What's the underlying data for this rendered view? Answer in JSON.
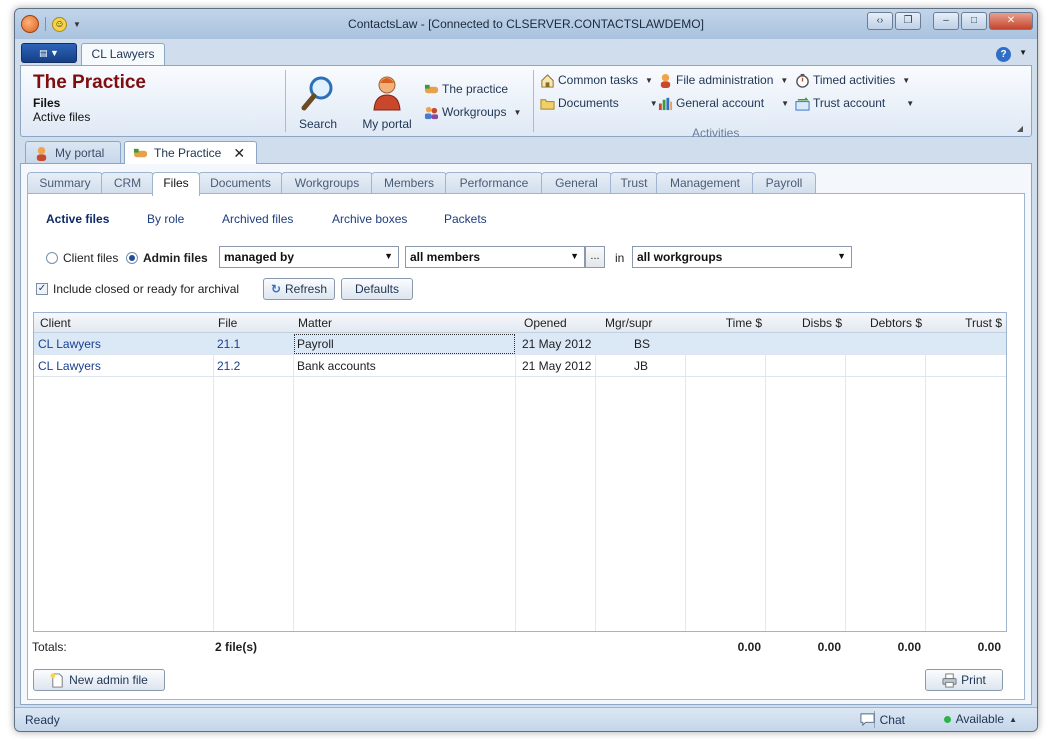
{
  "window": {
    "title": "ContactsLaw - [Connected to CLSERVER.CONTACTSLAWDEMO]"
  },
  "ribbon": {
    "tab_label": "CL Lawyers",
    "practice_title": "The Practice",
    "practice_sub": "Files",
    "practice_sub2": "Active files",
    "search_label": "Search",
    "my_portal_label": "My portal",
    "the_practice_label": "The practice",
    "workgroups_label": "Workgroups",
    "common_tasks_label": "Common tasks",
    "documents_label": "Documents",
    "file_admin_label": "File administration",
    "general_account_label": "General account",
    "timed_activities_label": "Timed activities",
    "trust_account_label": "Trust account",
    "activities_group_label": "Activities"
  },
  "doc_tabs": {
    "my_portal": "My portal",
    "the_practice": "The Practice"
  },
  "inner_tabs": [
    "Summary",
    "CRM",
    "Files",
    "Documents",
    "Workgroups",
    "Members",
    "Performance",
    "General",
    "Trust",
    "Management",
    "Payroll"
  ],
  "active_inner_tab": "Files",
  "subnav": {
    "active_files": "Active files",
    "by_role": "By role",
    "archived_files": "Archived files",
    "archive_boxes": "Archive boxes",
    "packets": "Packets"
  },
  "filters": {
    "client_files": "Client files",
    "admin_files": "Admin files",
    "selected_radio": "Admin files",
    "managed_by": "managed by",
    "members": "all members",
    "ellipsis": "...",
    "in_label": "in",
    "workgroups": "all workgroups",
    "include_closed": "Include closed or ready for archival",
    "include_closed_checked": true,
    "refresh": "Refresh",
    "defaults": "Defaults"
  },
  "grid": {
    "columns": [
      "Client",
      "File",
      "Matter",
      "Opened",
      "Mgr/supr",
      "Time $",
      "Disbs $",
      "Debtors $",
      "Trust $"
    ],
    "rows": [
      {
        "client": "CL Lawyers",
        "file": "21.1",
        "matter": "Payroll",
        "opened": "21 May 2012",
        "mgr": "BS",
        "time": "",
        "disbs": "",
        "debtors": "",
        "trust": ""
      },
      {
        "client": "CL Lawyers",
        "file": "21.2",
        "matter": "Bank accounts",
        "opened": "21 May 2012",
        "mgr": "JB",
        "time": "",
        "disbs": "",
        "debtors": "",
        "trust": ""
      }
    ]
  },
  "totals": {
    "label": "Totals:",
    "count": "2 file(s)",
    "time": "0.00",
    "disbs": "0.00",
    "debtors": "0.00",
    "trust": "0.00"
  },
  "buttons": {
    "new_admin_file": "New admin file",
    "print": "Print"
  },
  "status": {
    "ready": "Ready",
    "chat": "Chat",
    "available": "Available"
  }
}
